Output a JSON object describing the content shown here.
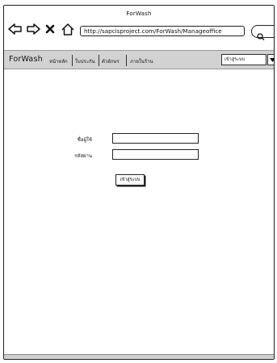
{
  "window": {
    "title": "ForWash"
  },
  "browser": {
    "back_icon": "back-arrow-icon",
    "forward_icon": "forward-arrow-icon",
    "close_icon": "close-x-icon",
    "home_icon": "home-icon",
    "url": "http://sapcisproject.com/ForWash/Manageoffice",
    "search_icon": "search-icon"
  },
  "menubar": {
    "brand": "ForWash",
    "items": [
      {
        "label": "หน้าหลัก"
      },
      {
        "label": "ใบประกัน"
      },
      {
        "label": "ตัวอักษร"
      },
      {
        "label": "ภายในร้าน"
      }
    ],
    "select": {
      "value": "เข้าสู่ระบบ"
    }
  },
  "login": {
    "username_label": "ชื่อผู้ใช้",
    "password_label": "รหัสผ่าน",
    "submit_label": "เข้าสู่ระบบ"
  }
}
